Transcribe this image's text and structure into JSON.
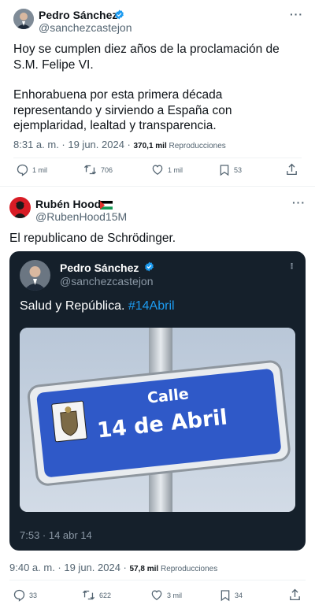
{
  "tweet1": {
    "author_name": "Pedro Sánchez",
    "author_handle": "@sanchezcastejon",
    "text_line1": "Hoy se cumplen diez años de la proclamación de",
    "text_line2": "S.M. Felipe VI.",
    "text_line3": "Enhorabuena por esta primera  década",
    "text_line4": "representando y sirviendo a España con",
    "text_line5": "ejemplaridad, lealtad y transparencia.",
    "time": "8:31 a. m. · 19 jun. 2024 · ",
    "views": "370,1 mil",
    "views_label": " Reproducciones",
    "replies": "1 mil",
    "retweets": "706",
    "likes": "1 mil",
    "bookmarks": "53"
  },
  "tweet2": {
    "author_name": "Rubén Hood",
    "author_handle": "@RubenHood15M",
    "text": "El republicano de Schrödinger.",
    "time": "9:40 a. m. · 19 jun. 2024 · ",
    "views": "57,8 mil",
    "views_label": " Reproducciones",
    "replies": "33",
    "retweets": "622",
    "likes": "3 mil",
    "bookmarks": "34"
  },
  "quoted": {
    "author_name": "Pedro Sánchez",
    "author_handle": "@sanchezcastejon",
    "text": "Salud y República. ",
    "hashtag": "#14Abril",
    "sign_word": "Calle",
    "sign_number": "14 de Abril",
    "time": "7:53 · 14 abr 14"
  },
  "colors": {
    "verified": "#1d9bf0",
    "text": "#0f1419",
    "muted": "#536471",
    "dark_card": "#15202b",
    "sign_blue": "#2f59c8"
  },
  "icons": [
    "verified-icon",
    "more-icon",
    "reply-icon",
    "retweet-icon",
    "like-icon",
    "bookmark-icon",
    "share-icon",
    "palestine-flag-icon"
  ]
}
